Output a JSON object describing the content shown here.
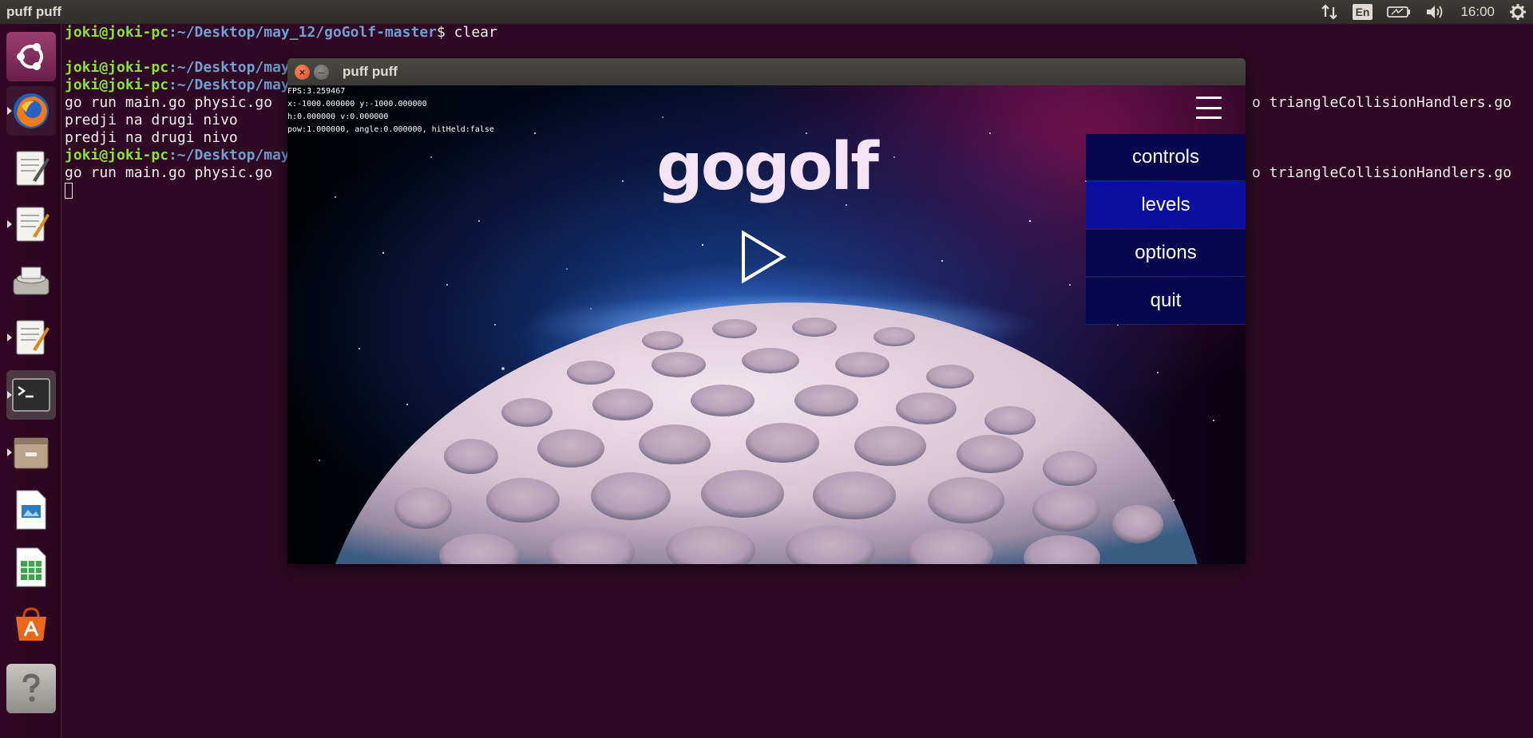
{
  "top_panel": {
    "app_title": "puff puff",
    "language": "En",
    "time": "16:00"
  },
  "launcher": {
    "items": [
      {
        "name": "ubuntu-dash",
        "icon": "ubuntu-logo-icon"
      },
      {
        "name": "firefox",
        "icon": "firefox-icon"
      },
      {
        "name": "text-editor-1",
        "icon": "text-editor-icon"
      },
      {
        "name": "text-editor-2",
        "icon": "text-editor-icon"
      },
      {
        "name": "scanner",
        "icon": "scanner-icon"
      },
      {
        "name": "text-editor-3",
        "icon": "text-editor-icon"
      },
      {
        "name": "terminal",
        "icon": "terminal-icon"
      },
      {
        "name": "files",
        "icon": "files-icon"
      },
      {
        "name": "libreoffice-impress",
        "icon": "impress-icon"
      },
      {
        "name": "libreoffice-calc",
        "icon": "calc-icon"
      },
      {
        "name": "software-center",
        "icon": "software-center-icon"
      },
      {
        "name": "help",
        "icon": "help-icon"
      }
    ]
  },
  "terminal": {
    "user": "joki@joki-pc",
    "lines": [
      {
        "prompt_user": "joki@joki-pc",
        "prompt_path": ":~/Desktop/may_12/goGolf-master",
        "text": "$ clear"
      },
      {
        "text": ""
      },
      {
        "prompt_user": "joki@joki-pc",
        "prompt_path": ":~/Desktop/may",
        "text": ""
      },
      {
        "prompt_user": "joki@joki-pc",
        "prompt_path": ":~/Desktop/may",
        "text": ""
      },
      {
        "text": "go run main.go physic.go",
        "tail": "o triangleCollisionHandlers.go"
      },
      {
        "text": "predji na drugi nivo"
      },
      {
        "text": "predji na drugi nivo"
      },
      {
        "prompt_user": "joki@joki-pc",
        "prompt_path": ":~/Desktop/may",
        "text": ""
      },
      {
        "text": "go run main.go physic.go",
        "tail": "o triangleCollisionHandlers.go"
      }
    ]
  },
  "game_window": {
    "title": "puff puff",
    "debug": [
      "FPS:3.259467",
      "x:-1000.000000 y:-1000.000000",
      "h:0.000000 v:0.000000",
      "pow:1.000000, angle:0.000000, hitHeld:false"
    ],
    "logo": "gogolf",
    "menu": [
      {
        "label": "controls",
        "active": false
      },
      {
        "label": "levels",
        "active": true
      },
      {
        "label": "options",
        "active": false
      },
      {
        "label": "quit",
        "active": false
      }
    ],
    "colors": {
      "menu_bg": "#06084f",
      "menu_active_bg": "#0a0fa0",
      "logo": "#f4e3f5"
    }
  }
}
